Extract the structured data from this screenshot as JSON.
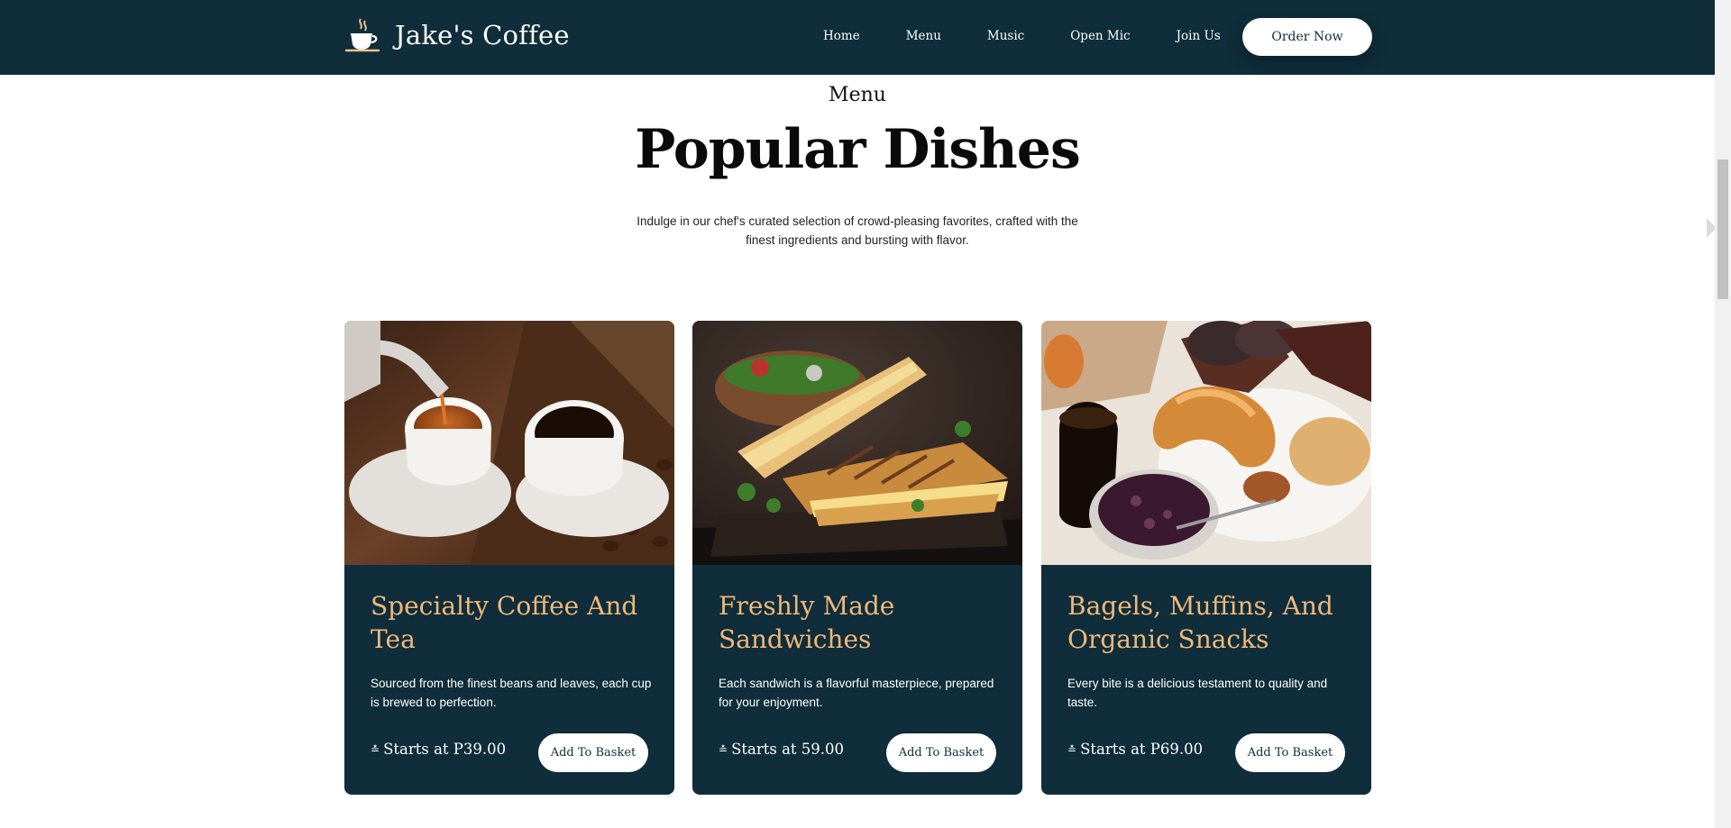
{
  "brand": {
    "name": "Jake's Coffee",
    "logo_icon": "coffee-cup-icon"
  },
  "nav": {
    "items": [
      "Home",
      "Menu",
      "Music",
      "Open Mic",
      "Join Us"
    ],
    "cta": "Order Now"
  },
  "section": {
    "kicker": "Menu",
    "title": "Popular Dishes",
    "subtitle": "Indulge in our chef's curated selection of crowd-pleasing favorites, crafted with the finest ingredients and bursting with flavor."
  },
  "cards": [
    {
      "title": "Specialty Coffee And Tea",
      "description": "Sourced from the finest beans and leaves, each cup is brewed to perfection.",
      "price_mark": "≛",
      "price": "Starts at P39.00",
      "button": "Add To Basket",
      "image": "coffee-and-tea-photo"
    },
    {
      "title": "Freshly Made Sandwiches",
      "description": "Each sandwich is a flavorful masterpiece, prepared for your enjoyment.",
      "price_mark": "≛",
      "price": "Starts at 59.00",
      "button": "Add To Basket",
      "image": "grilled-sandwich-photo"
    },
    {
      "title": "Bagels, Muffins, And Organic Snacks",
      "description": "Every bite is a delicious testament to quality and taste.",
      "price_mark": "≛",
      "price": "Starts at P69.00",
      "button": "Add To Basket",
      "image": "pastries-photo"
    }
  ],
  "colors": {
    "header": "#0f2d3a",
    "card": "#0f2d3a",
    "card_title": "#f0b87a"
  }
}
